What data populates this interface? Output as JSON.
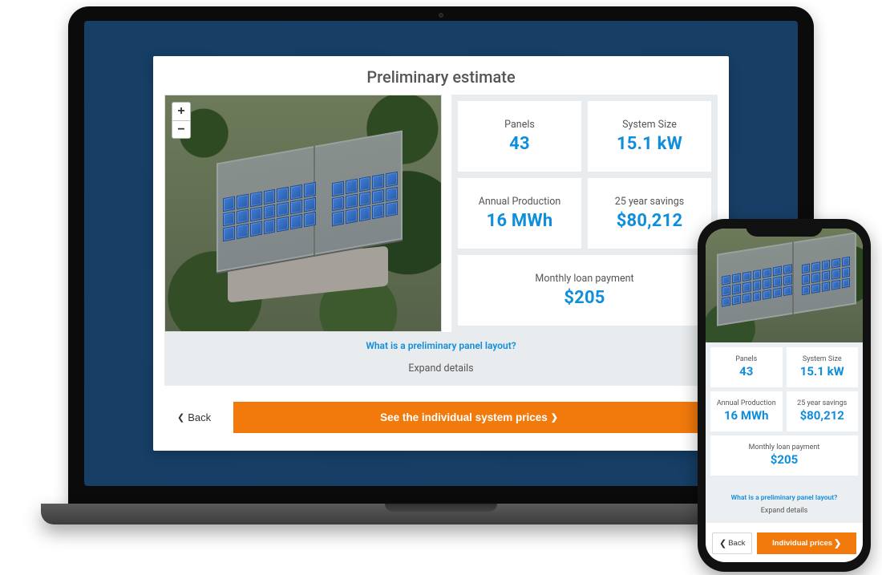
{
  "title": "Preliminary estimate",
  "zoom": {
    "in": "+",
    "out": "−"
  },
  "stats": {
    "panels": {
      "label": "Panels",
      "value": "43"
    },
    "system_size": {
      "label": "System Size",
      "value": "15.1 kW"
    },
    "annual": {
      "label": "Annual Production",
      "value": "16 MWh"
    },
    "savings": {
      "label": "25 year savings",
      "value": "$80,212"
    },
    "monthly": {
      "label": "Monthly loan payment",
      "value": "$205"
    }
  },
  "helper_link": "What is a preliminary panel layout?",
  "expand": "Expand details",
  "back": "Back",
  "cta": "See the individual system prices",
  "phone_cta": "Individual prices"
}
